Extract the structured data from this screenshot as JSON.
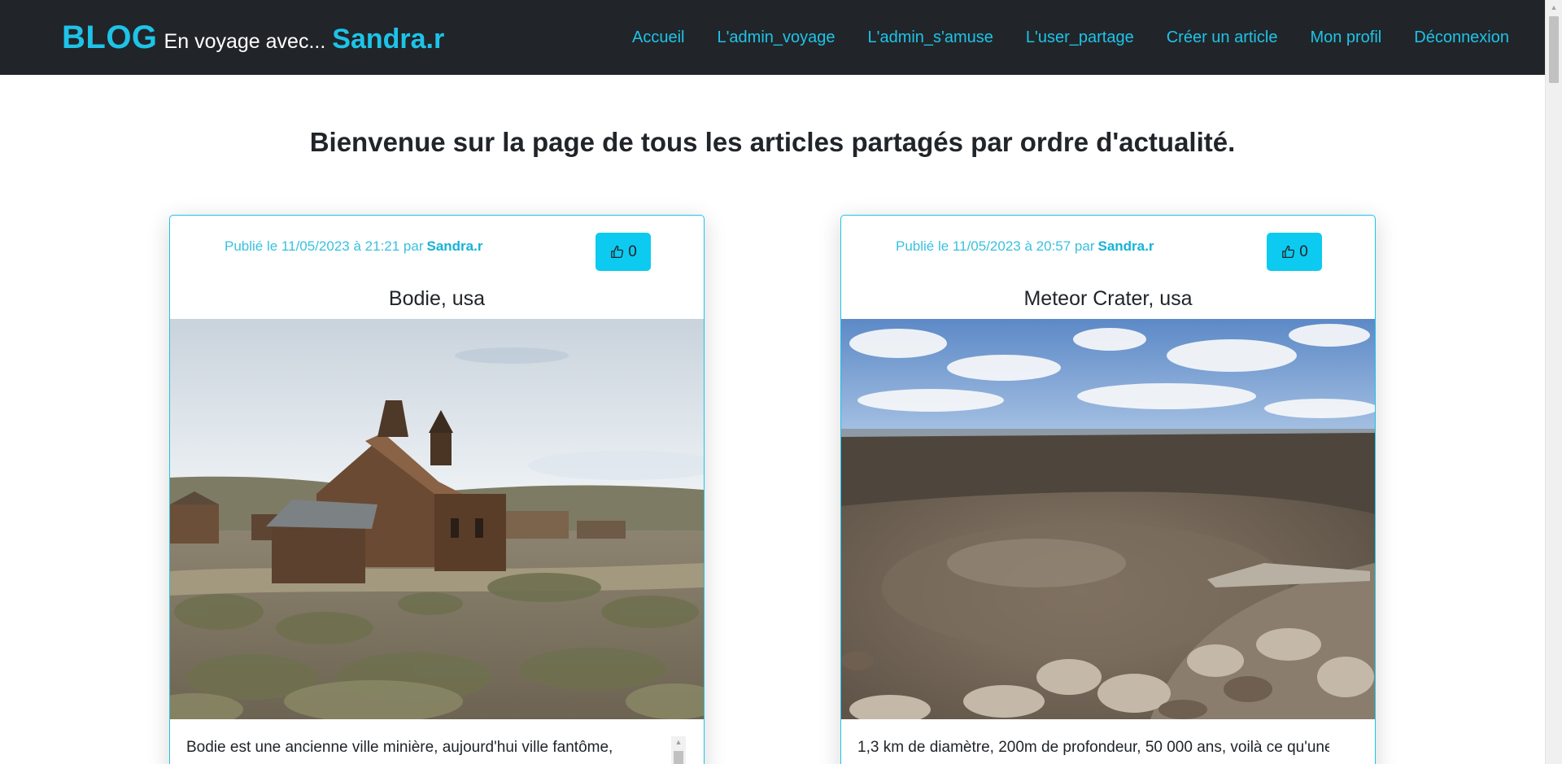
{
  "navbar": {
    "brand_blog": "BLOG",
    "brand_mid": "En voyage avec...",
    "brand_user": "Sandra.r",
    "links": [
      "Accueil",
      "L'admin_voyage",
      "L'admin_s'amuse",
      "L'user_partage",
      "Créer un article",
      "Mon profil",
      "Déconnexion"
    ]
  },
  "page": {
    "title": "Bienvenue sur la page de tous les articles partagés par ordre d'actualité."
  },
  "articles": [
    {
      "published": "Publié le 11/05/2023 à 21:21 par",
      "author": "Sandra.r",
      "likes": "0",
      "title": "Bodie, usa",
      "text": "Bodie est une ancienne ville minière, aujourd'hui ville fantôme,",
      "image_icon": "ghost-town-church-photo"
    },
    {
      "published": "Publié le 11/05/2023 à 20:57 par",
      "author": "Sandra.r",
      "likes": "0",
      "title": "Meteor Crater, usa",
      "text": "1,3 km de diamètre, 200m de profondeur, 50 000 ans, voilà ce qu'une",
      "image_icon": "meteor-crater-photo"
    }
  ],
  "colors": {
    "navbar_bg": "#212529",
    "accent": "#1ec3e8",
    "like_button": "#0dcaf0"
  }
}
